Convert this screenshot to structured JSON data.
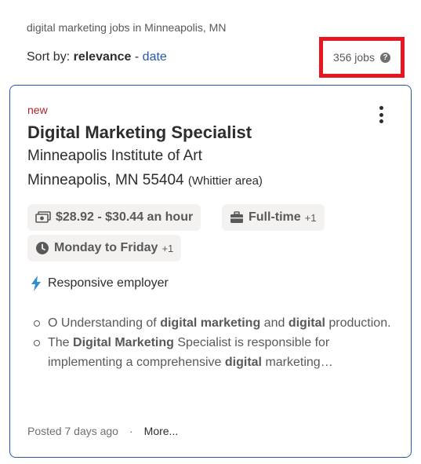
{
  "search_caption": "digital marketing jobs in Minneapolis, MN",
  "sort": {
    "prefix": "Sort by:",
    "active": "relevance",
    "separator": "-",
    "alt": "date"
  },
  "job_count": "356 jobs",
  "colors": {
    "accent": "#2557a7",
    "new": "#a9252b",
    "highlight_box": "#e8161e",
    "bolt": "#2f8fce"
  },
  "job": {
    "new_label": "new",
    "title": "Digital Marketing Specialist",
    "company": "Minneapolis Institute of Art",
    "location": "Minneapolis, MN 55404",
    "area": "(Whittier area)",
    "salary": "$28.92 - $30.44 an hour",
    "job_type": "Full-time",
    "job_type_more": "+1",
    "schedule": "Monday to Friday",
    "schedule_more": "+1",
    "responsive_label": "Responsive employer",
    "snippets": [
      {
        "p1": "O Understanding of ",
        "b1": "digital marketing",
        "p2": " and ",
        "b2": "digital",
        "p3": " production."
      },
      {
        "p1": "The ",
        "b1": "Digital Marketing",
        "p2": " Specialist is responsible for implementing a comprehensive ",
        "b2": "digital",
        "p3": " marketing…"
      }
    ],
    "posted": "Posted 7 days ago",
    "dot": "·",
    "more_label": "More..."
  },
  "icons": {
    "help": "question-circle-icon",
    "kebab": "more-vertical-icon",
    "salary": "money-bill-icon",
    "job_type": "briefcase-icon",
    "schedule": "clock-icon",
    "responsive": "lightning-bolt-icon"
  }
}
